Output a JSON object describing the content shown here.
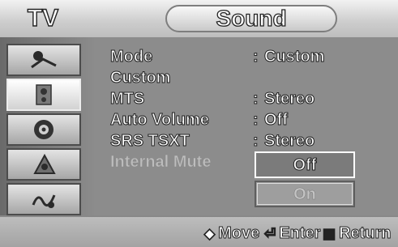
{
  "header": {
    "tab_label": "TV",
    "title": "Sound"
  },
  "sidebar": {
    "items": [
      {
        "icon": "picture-icon",
        "selected": false
      },
      {
        "icon": "sound-icon",
        "selected": true
      },
      {
        "icon": "channel-icon",
        "selected": false
      },
      {
        "icon": "setup-icon",
        "selected": false
      },
      {
        "icon": "input-icon",
        "selected": false
      }
    ]
  },
  "menu": {
    "rows": [
      {
        "label": "Mode",
        "colon": ":",
        "value": "Custom"
      },
      {
        "label": "Custom",
        "colon": "",
        "value": ""
      },
      {
        "label": "MTS",
        "colon": ":",
        "value": "Stereo"
      },
      {
        "label": "Auto Volume",
        "colon": ":",
        "value": "Off"
      },
      {
        "label": "SRS TSXT",
        "colon": ":",
        "value": "Stereo"
      },
      {
        "label": "Internal Mute",
        "colon": ":",
        "value": "",
        "disabled": true
      }
    ]
  },
  "dropdown": {
    "options": [
      "Off",
      "On"
    ],
    "highlighted": "Off"
  },
  "footer": {
    "move": {
      "glyph": "◆",
      "label": "Move"
    },
    "enter": {
      "glyph": "⏎",
      "label": "Enter"
    },
    "return": {
      "glyph": "▥",
      "label": "Return"
    }
  }
}
